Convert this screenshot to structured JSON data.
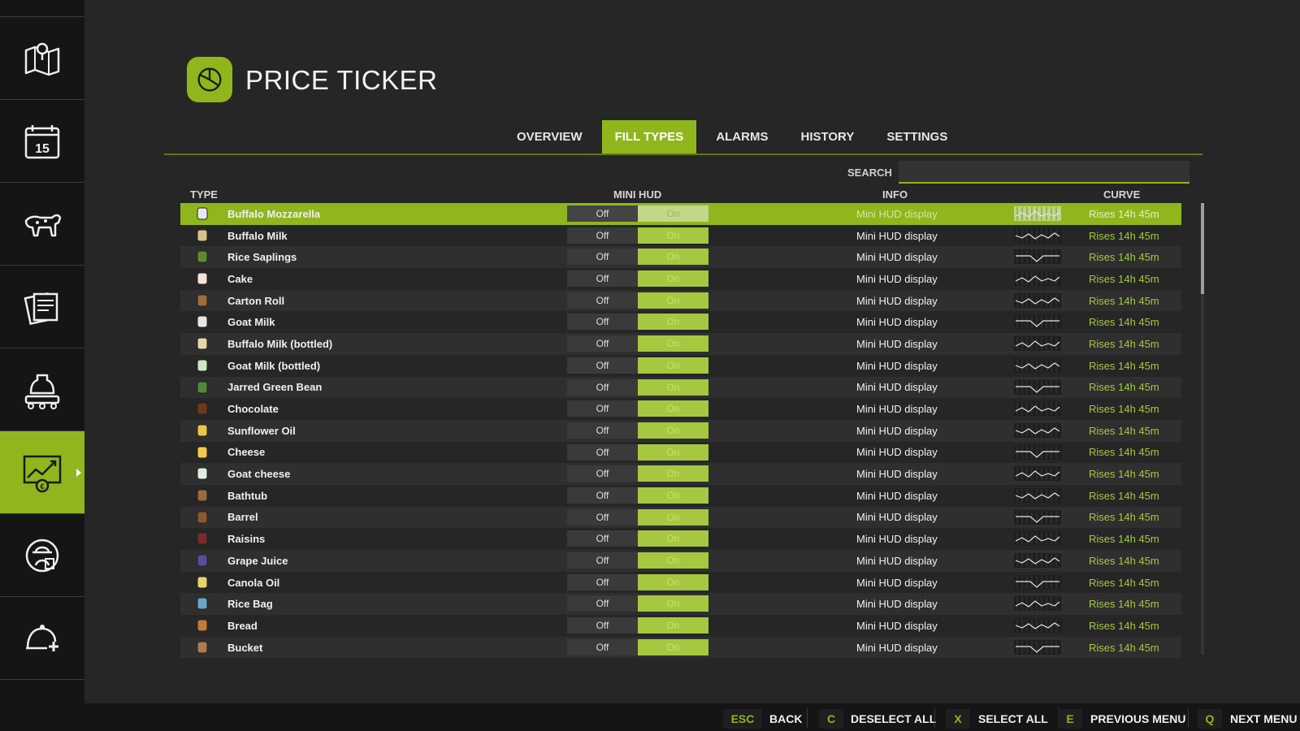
{
  "page_title": "PRICE TICKER",
  "sidebar": {
    "items": [
      {
        "icon": "map-icon"
      },
      {
        "icon": "calendar-icon",
        "label": "15"
      },
      {
        "icon": "animals-icon"
      },
      {
        "icon": "contracts-icon"
      },
      {
        "icon": "production-icon"
      },
      {
        "icon": "price-chart-icon",
        "active": true
      },
      {
        "icon": "farmer-icon"
      },
      {
        "icon": "help-icon"
      }
    ]
  },
  "tabs": [
    {
      "label": "OVERVIEW"
    },
    {
      "label": "FILL TYPES",
      "active": true
    },
    {
      "label": "ALARMS"
    },
    {
      "label": "HISTORY"
    },
    {
      "label": "SETTINGS"
    }
  ],
  "search": {
    "label": "SEARCH",
    "value": ""
  },
  "columns": {
    "type": "TYPE",
    "mini_hud": "MINI HUD",
    "info": "INFO",
    "curve": "CURVE"
  },
  "rows": [
    {
      "name": "Buffalo Mozzarella",
      "selected": true,
      "off": "Off",
      "on": "On",
      "info": "Mini HUD display",
      "curve": "Rises 14h 45m",
      "icon_color": "#e8e8e8"
    },
    {
      "name": "Buffalo Milk",
      "off": "Off",
      "on": "On",
      "info": "Mini HUD display",
      "curve": "Rises 14h 45m",
      "icon_color": "#d9c38a"
    },
    {
      "name": "Rice Saplings",
      "off": "Off",
      "on": "On",
      "info": "Mini HUD display",
      "curve": "Rises 14h 45m",
      "icon_color": "#5e8a2e"
    },
    {
      "name": "Cake",
      "off": "Off",
      "on": "On",
      "info": "Mini HUD display",
      "curve": "Rises 14h 45m",
      "icon_color": "#f3e2d6"
    },
    {
      "name": "Carton Roll",
      "off": "Off",
      "on": "On",
      "info": "Mini HUD display",
      "curve": "Rises 14h 45m",
      "icon_color": "#a06c3a"
    },
    {
      "name": "Goat Milk",
      "off": "Off",
      "on": "On",
      "info": "Mini HUD display",
      "curve": "Rises 14h 45m",
      "icon_color": "#e5e5e5"
    },
    {
      "name": "Buffalo Milk (bottled)",
      "off": "Off",
      "on": "On",
      "info": "Mini HUD display",
      "curve": "Rises 14h 45m",
      "icon_color": "#e3d7a6"
    },
    {
      "name": "Goat Milk (bottled)",
      "off": "Off",
      "on": "On",
      "info": "Mini HUD display",
      "curve": "Rises 14h 45m",
      "icon_color": "#cfe6c2"
    },
    {
      "name": "Jarred Green Bean",
      "off": "Off",
      "on": "On",
      "info": "Mini HUD display",
      "curve": "Rises 14h 45m",
      "icon_color": "#4f8a3c"
    },
    {
      "name": "Chocolate",
      "off": "Off",
      "on": "On",
      "info": "Mini HUD display",
      "curve": "Rises 14h 45m",
      "icon_color": "#6b3a1e"
    },
    {
      "name": "Sunflower Oil",
      "off": "Off",
      "on": "On",
      "info": "Mini HUD display",
      "curve": "Rises 14h 45m",
      "icon_color": "#e8c74a"
    },
    {
      "name": "Cheese",
      "off": "Off",
      "on": "On",
      "info": "Mini HUD display",
      "curve": "Rises 14h 45m",
      "icon_color": "#f2c94c"
    },
    {
      "name": "Goat cheese",
      "off": "Off",
      "on": "On",
      "info": "Mini HUD display",
      "curve": "Rises 14h 45m",
      "icon_color": "#dfeee0"
    },
    {
      "name": "Bathtub",
      "off": "Off",
      "on": "On",
      "info": "Mini HUD display",
      "curve": "Rises 14h 45m",
      "icon_color": "#9a6a3e"
    },
    {
      "name": "Barrel",
      "off": "Off",
      "on": "On",
      "info": "Mini HUD display",
      "curve": "Rises 14h 45m",
      "icon_color": "#8a5a32"
    },
    {
      "name": "Raisins",
      "off": "Off",
      "on": "On",
      "info": "Mini HUD display",
      "curve": "Rises 14h 45m",
      "icon_color": "#7a2a2a"
    },
    {
      "name": "Grape Juice",
      "off": "Off",
      "on": "On",
      "info": "Mini HUD display",
      "curve": "Rises 14h 45m",
      "icon_color": "#5a4b9a"
    },
    {
      "name": "Canola Oil",
      "off": "Off",
      "on": "On",
      "info": "Mini HUD display",
      "curve": "Rises 14h 45m",
      "icon_color": "#e8d36a"
    },
    {
      "name": "Rice Bag",
      "off": "Off",
      "on": "On",
      "info": "Mini HUD display",
      "curve": "Rises 14h 45m",
      "icon_color": "#6aa6c8"
    },
    {
      "name": "Bread",
      "off": "Off",
      "on": "On",
      "info": "Mini HUD display",
      "curve": "Rises 14h 45m",
      "icon_color": "#c07a3a"
    },
    {
      "name": "Bucket",
      "off": "Off",
      "on": "On",
      "info": "Mini HUD display",
      "curve": "Rises 14h 45m",
      "icon_color": "#b07a4a"
    }
  ],
  "footer": [
    {
      "key": "ESC",
      "label": "BACK"
    },
    {
      "key": "C",
      "label": "DESELECT ALL"
    },
    {
      "key": "X",
      "label": "SELECT ALL"
    },
    {
      "key": "E",
      "label": "PREVIOUS MENU"
    },
    {
      "key": "Q",
      "label": "NEXT MENU"
    }
  ],
  "colors": {
    "accent": "#8fb61d",
    "background": "#262626",
    "sidebar": "#151515"
  }
}
